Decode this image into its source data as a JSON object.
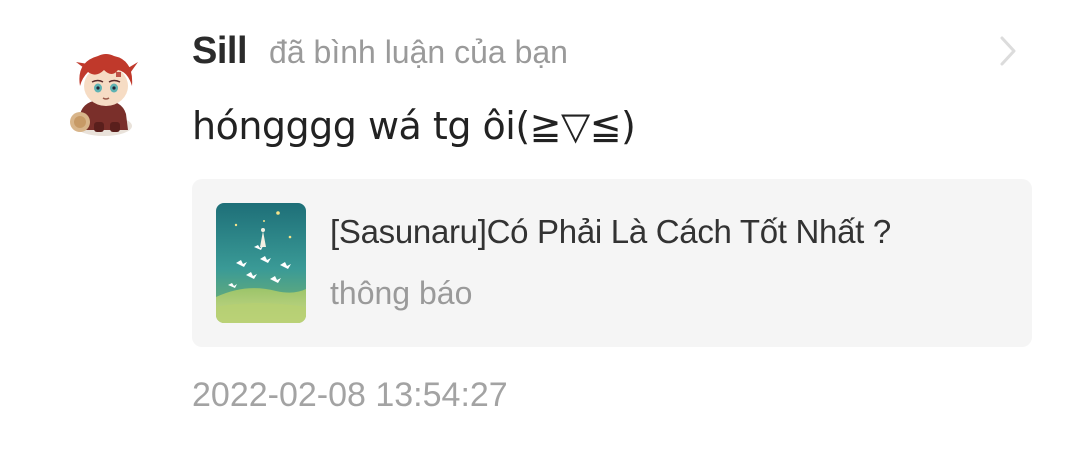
{
  "notification": {
    "username": "Sill",
    "action_text": "đã bình luận của bạn",
    "comment": "hóngggg wá tg ôi(≧▽≦)",
    "story_card": {
      "title": "[Sasunaru]Có Phải Là Cách Tốt Nhất ?",
      "subtitle": "thông báo"
    },
    "timestamp": "2022-02-08 13:54:27"
  },
  "icons": {
    "avatar": "user-avatar-icon",
    "chevron": "chevron-right-icon",
    "cover": "story-cover-image"
  },
  "colors": {
    "username": "#2b2b2b",
    "muted_text": "#9a9a9a",
    "card_background": "#f5f5f5",
    "cover_teal": "#2a8a8a",
    "avatar_hair": "#c0392b"
  }
}
